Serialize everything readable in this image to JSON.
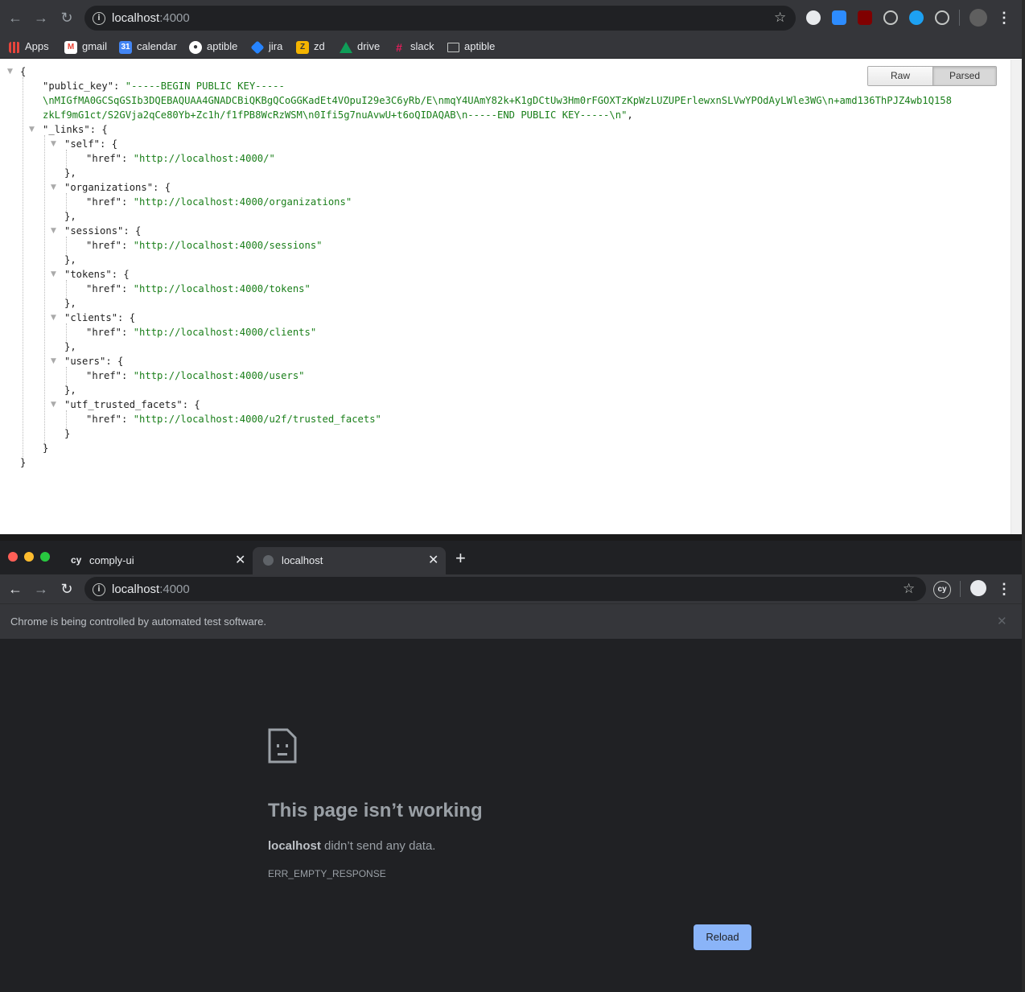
{
  "top_window": {
    "omnibox": {
      "host": "localhost",
      "port": ":4000"
    },
    "bookmarks": [
      {
        "label": "Apps",
        "icon": "apps-grid-icon",
        "color": "#e8453c"
      },
      {
        "label": "gmail",
        "icon": "gmail-icon",
        "color": "#ea4335"
      },
      {
        "label": "calendar",
        "icon": "calendar-icon",
        "icon_text": "31",
        "color": "#4285f4"
      },
      {
        "label": "aptible",
        "icon": "github-icon",
        "color": "#ffffff"
      },
      {
        "label": "jira",
        "icon": "jira-icon",
        "color": "#2684ff"
      },
      {
        "label": "zd",
        "icon": "zendesk-icon",
        "color": "#f4b400"
      },
      {
        "label": "drive",
        "icon": "drive-icon",
        "color": "#0f9d58"
      },
      {
        "label": "slack",
        "icon": "slack-icon",
        "color": "#e01e5a"
      },
      {
        "label": "aptible",
        "icon": "folder-icon",
        "color": "#c4c7c5"
      }
    ],
    "json_viewer": {
      "raw_label": "Raw",
      "parsed_label": "Parsed",
      "lines": {
        "open_brace": "{",
        "public_key_key": "\"public_key\": ",
        "public_key_l1": "\"-----BEGIN PUBLIC KEY-----",
        "public_key_l2": "\\nMIGfMA0GCSqGSIb3DQEBAQUAA4GNADCBiQKBgQCoGGKadEt4VOpuI29e3C6yRb/E\\nmqY4UAmY82k+K1gDCtUw3Hm0rFGOXTzKpWzLUZUPErlewxnSLVwYPOdAyLWle3WG\\n+amd136ThPJZ4wb1Q158",
        "public_key_l3": "zkLf9mG1ct/S2GVja2qCe80Yb+Zc1h/f1fPB8WcRzWSM\\n0Ifi5g7nuAvwU+t6oQIDAQAB\\n-----END PUBLIC KEY-----\\n\"",
        "public_key_comma": ",",
        "links_key": "\"_links\": {",
        "close_brace": "}",
        "close_brace_comma": "},",
        "href_key": "\"href\": "
      },
      "links": [
        {
          "key": "\"self\": {",
          "href": "\"http://localhost:4000/\""
        },
        {
          "key": "\"organizations\": {",
          "href": "\"http://localhost:4000/organizations\""
        },
        {
          "key": "\"sessions\": {",
          "href": "\"http://localhost:4000/sessions\""
        },
        {
          "key": "\"tokens\": {",
          "href": "\"http://localhost:4000/tokens\""
        },
        {
          "key": "\"clients\": {",
          "href": "\"http://localhost:4000/clients\""
        },
        {
          "key": "\"users\": {",
          "href": "\"http://localhost:4000/users\""
        },
        {
          "key": "\"utf_trusted_facets\": {",
          "href": "\"http://localhost:4000/u2f/trusted_facets\""
        }
      ]
    }
  },
  "bottom_window": {
    "tabs": [
      {
        "title": "comply-ui",
        "icon_text": "cy"
      },
      {
        "title": "localhost"
      }
    ],
    "omnibox": {
      "host": "localhost",
      "port": ":4000"
    },
    "extension_text": "cy",
    "infobar_text": "Chrome is being controlled by automated test software.",
    "error": {
      "title": "This page isn’t working",
      "host": "localhost",
      "message": " didn’t send any data.",
      "code": "ERR_EMPTY_RESPONSE",
      "reload_label": "Reload"
    }
  }
}
